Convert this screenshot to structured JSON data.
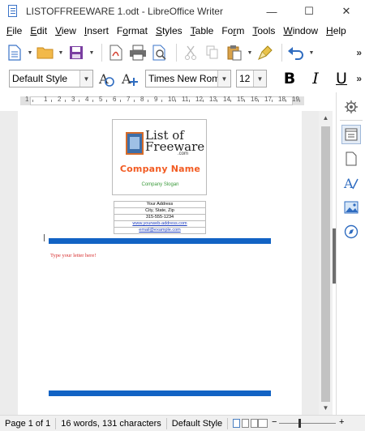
{
  "window": {
    "title": "LISTOFFREEWARE 1.odt - LibreOffice Writer",
    "minimize": "—",
    "maximize": "☐",
    "close": "✕"
  },
  "menu": [
    {
      "label": "File",
      "key": "F",
      "rest": "ile"
    },
    {
      "label": "Edit",
      "key": "E",
      "rest": "dit"
    },
    {
      "label": "View",
      "key": "V",
      "rest": "iew"
    },
    {
      "label": "Insert",
      "key": "I",
      "rest": "nsert"
    },
    {
      "label": "Format",
      "pre": "F",
      "key": "o",
      "rest": "rmat"
    },
    {
      "label": "Styles",
      "key": "S",
      "rest": "tyles"
    },
    {
      "label": "Table",
      "key": "T",
      "rest": "able"
    },
    {
      "label": "Form",
      "pre": "Fo",
      "key": "r",
      "rest": "m"
    },
    {
      "label": "Tools",
      "key": "T",
      "rest": "ools"
    },
    {
      "label": "Window",
      "key": "W",
      "rest": "indow"
    },
    {
      "label": "Help",
      "key": "H",
      "rest": "elp"
    }
  ],
  "toolbar": {
    "more": "»",
    "icons": [
      "new-document-icon",
      "open-folder-icon",
      "save-icon",
      "export-pdf-icon",
      "print-icon",
      "print-preview-icon",
      "cut-icon",
      "copy-icon",
      "paste-icon",
      "clone-formatting-icon",
      "undo-icon"
    ]
  },
  "formatting": {
    "paragraph_style": "Default Style",
    "font_name": "Times New Roman",
    "font_size": "12",
    "bold": "B",
    "italic": "I",
    "underline": "U",
    "more": "»"
  },
  "ruler": {
    "numbers": [
      "1",
      "1",
      "2",
      "3",
      "4",
      "5",
      "6",
      "7",
      "8",
      "9",
      "10",
      "11",
      "12",
      "13",
      "14",
      "15",
      "16",
      "17",
      "18",
      "19"
    ]
  },
  "document": {
    "logo_text_line1": "List of",
    "logo_text_line2": "Freeware",
    "logo_domain": ".com",
    "company_name": "Company Name",
    "company_slogan": "Company Slogan",
    "address_rows": [
      "Your Address",
      "City, State, Zip",
      "315-555-1234",
      "www.yourweb-address.com",
      "email@example.com"
    ],
    "letter_placeholder": "Type your letter here!"
  },
  "status": {
    "page": "Page 1 of 1",
    "words": "16 words, 131 characters",
    "style": "Default Style",
    "zoom_minus": "−",
    "zoom_plus": "+"
  },
  "colors": {
    "company_name": "#f25b22",
    "slogan": "#3b9a3b",
    "blue_bar": "#1263c4",
    "letter_text": "#d62a2a"
  }
}
